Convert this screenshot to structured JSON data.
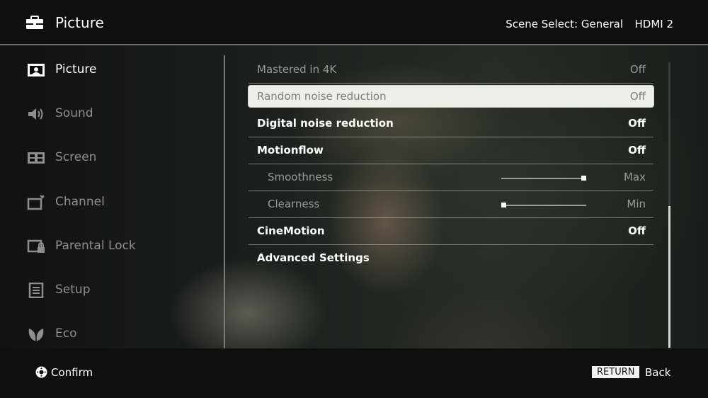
{
  "header": {
    "title": "Picture",
    "scene_select": "Scene Select: General",
    "input": "HDMI 2"
  },
  "sidebar": {
    "items": [
      {
        "label": "Picture",
        "icon": "picture-icon",
        "active": true
      },
      {
        "label": "Sound",
        "icon": "speaker-icon",
        "active": false
      },
      {
        "label": "Screen",
        "icon": "screen-icon",
        "active": false
      },
      {
        "label": "Channel",
        "icon": "channel-icon",
        "active": false
      },
      {
        "label": "Parental Lock",
        "icon": "lock-icon",
        "active": false
      },
      {
        "label": "Setup",
        "icon": "setup-icon",
        "active": false
      },
      {
        "label": "Eco",
        "icon": "eco-leaf-icon",
        "active": false
      }
    ]
  },
  "settings": {
    "rows": [
      {
        "label": "Mastered in 4K",
        "value": "Off",
        "style": "dim"
      },
      {
        "label": "Random noise reduction",
        "value": "Off",
        "style": "selected"
      },
      {
        "label": "Digital noise reduction",
        "value": "Off",
        "style": "bold"
      },
      {
        "label": "Motionflow",
        "value": "Off",
        "style": "bold"
      },
      {
        "label": "Smoothness",
        "value": "Max",
        "style": "sub",
        "slider_level": 1.0
      },
      {
        "label": "Clearness",
        "value": "Min",
        "style": "sub",
        "slider_level": 0.0
      },
      {
        "label": "CineMotion",
        "value": "Off",
        "style": "bold"
      },
      {
        "label": "Advanced Settings",
        "value": "",
        "style": "bold"
      }
    ]
  },
  "footer": {
    "confirm": "Confirm",
    "return_key": "RETURN",
    "back": "Back"
  },
  "colors": {
    "selected_row_bg": "#eeefe9",
    "text_dim": "#9a9b98",
    "bar_bg": "#0e0f11"
  }
}
